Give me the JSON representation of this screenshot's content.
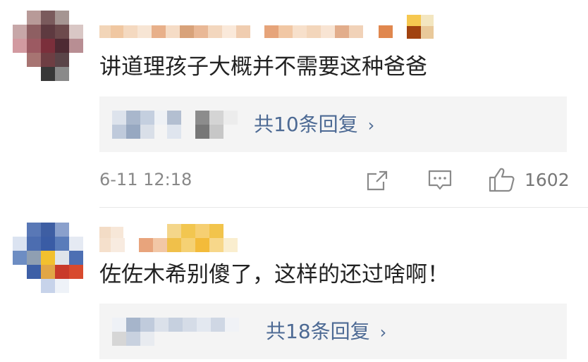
{
  "comments": [
    {
      "text": "讲道理孩子大概并不需要这种爸爸",
      "replies_label": "共10条回复",
      "time": "6-11 12:18",
      "like_count": "1602"
    },
    {
      "text": "佐佐木希别傻了，这样的还过啥啊！",
      "replies_label": "共18条回复"
    }
  ],
  "icons": {
    "share": "share-icon",
    "comment": "comment-icon",
    "like": "thumbs-up-icon",
    "chevron": "chevron-right-icon"
  },
  "colors": {
    "link": "#4d6a94",
    "meta": "#888888",
    "reply_bg": "#f4f4f4"
  }
}
